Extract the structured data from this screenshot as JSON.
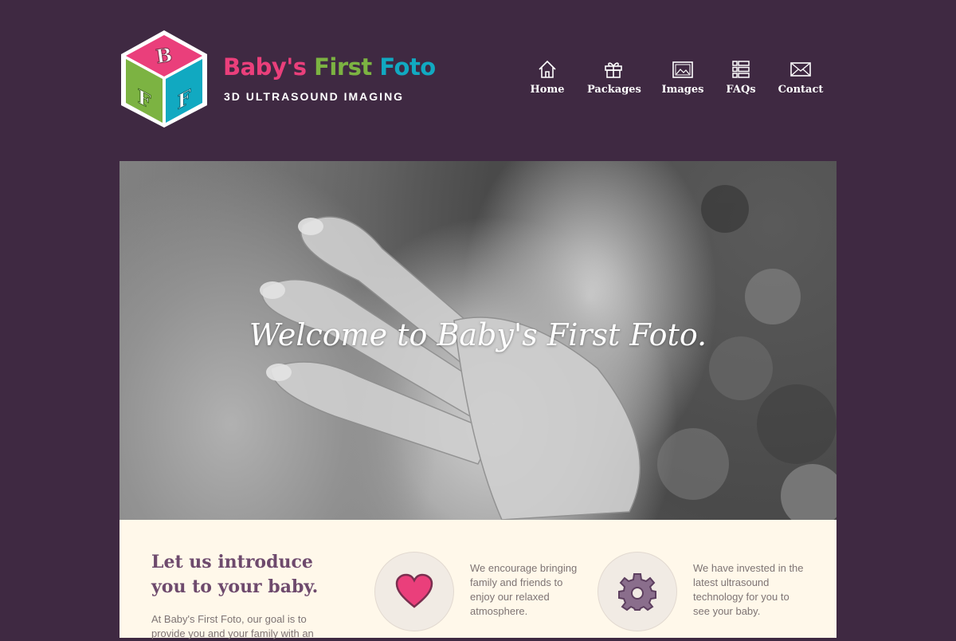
{
  "brand": {
    "logo_letters": [
      "B",
      "F",
      "F"
    ],
    "name_parts": [
      "Baby's",
      "First",
      "Foto"
    ],
    "tagline": "3D ULTRASOUND IMAGING"
  },
  "nav": {
    "items": [
      {
        "label": "Home",
        "icon": "home-icon"
      },
      {
        "label": "Packages",
        "icon": "gift-icon"
      },
      {
        "label": "Images",
        "icon": "picture-icon"
      },
      {
        "label": "FAQs",
        "icon": "list-icon"
      },
      {
        "label": "Contact",
        "icon": "envelope-icon"
      }
    ]
  },
  "hero": {
    "title": "Welcome to Baby's First Foto."
  },
  "intro": {
    "heading": "Let us introduce you to your baby.",
    "text": "At Baby's First Foto, our goal is to provide you and your family with an"
  },
  "features": [
    {
      "icon": "heart-icon",
      "text": "We encourage bringing family and friends to enjoy our relaxed atmosphere."
    },
    {
      "icon": "gear-icon",
      "text": "We have invested in the latest ultrasound technology for you to see your baby."
    }
  ],
  "colors": {
    "background": "#3f2942",
    "brand_pink": "#ea3f7b",
    "brand_green": "#7cb342",
    "brand_teal": "#11a9c1",
    "intro_background": "#fff8ea",
    "heading_purple": "#6e4a6d",
    "gear_purple": "#8a6e8c"
  }
}
